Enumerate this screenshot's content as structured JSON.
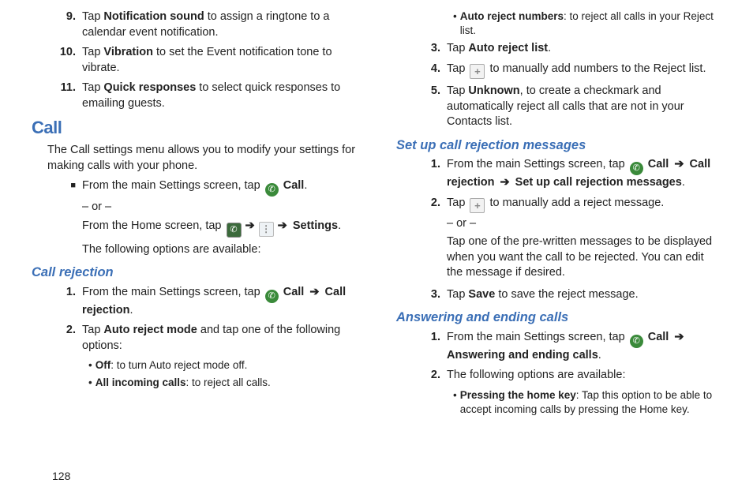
{
  "page_number": "128",
  "col1": {
    "step9_num": "9.",
    "step9_a": "Tap ",
    "step9_b": "Notification sound",
    "step9_c": " to assign a ringtone to a calendar event notification.",
    "step10_num": "10.",
    "step10_a": "Tap ",
    "step10_b": "Vibration",
    "step10_c": " to set the Event notification tone to vibrate.",
    "step11_num": "11.",
    "step11_a": "Tap ",
    "step11_b": "Quick responses",
    "step11_c": " to select quick responses to emailing guests.",
    "h_call": "Call",
    "call_intro": "The Call settings menu allows you to modify your settings for making calls with your phone.",
    "sq_bullet": "■",
    "main_a": "From the main Settings screen, tap ",
    "icon_phone": "✆",
    "call_label": " Call",
    "period": ".",
    "or": "– or –",
    "home_a": "From the Home screen, tap ",
    "icon_menu": "⋮",
    "arrow": "➔",
    "settings": " Settings",
    "options_avail": "The following options are available:",
    "h_rejection": "Call rejection",
    "r1_num": "1.",
    "r1_a": "From the main Settings screen, tap ",
    "r1_b": " Call ",
    "r1_c": " Call rejection",
    "r2_num": "2.",
    "r2_a": "Tap ",
    "r2_b": "Auto reject mode",
    "r2_c": " and tap one of the following options:",
    "off_b": "Off",
    "off_c": ": to turn Auto reject mode off.",
    "all_b": "All incoming calls",
    "all_c": ": to reject all calls.",
    "dot": "•"
  },
  "col2": {
    "arn_b": "Auto reject numbers",
    "arn_c": ": to reject all calls in your Reject list.",
    "s3_num": "3.",
    "s3_a": "Tap ",
    "s3_b": "Auto reject list",
    "s4_num": "4.",
    "s4_a": "Tap ",
    "icon_plus": "+",
    "s4_c": " to manually add numbers to the Reject list.",
    "s5_num": "5.",
    "s5_a": "Tap ",
    "s5_b": "Unknown",
    "s5_c": ", to create a checkmark and automatically reject all calls that are not in your Contacts list.",
    "h_msgs": "Set up call rejection messages",
    "m1_num": "1.",
    "m1_a": "From the main Settings screen, tap ",
    "m1_b": " Call ",
    "m1_c": " Call rejection ",
    "m1_d": " Set up call rejection messages",
    "m2_num": "2.",
    "m2_a": "Tap ",
    "m2_c": " to manually add a reject message.",
    "or": "– or –",
    "m2_sub": "Tap one of the pre-written messages to be displayed when you want the call to be rejected. You can edit the message if desired.",
    "m3_num": "3.",
    "m3_a": "Tap ",
    "m3_b": "Save",
    "m3_c": " to save the reject message.",
    "h_ans": "Answering and ending calls",
    "a1_num": "1.",
    "a1_a": "From the main Settings screen, tap ",
    "a1_b": " Call ",
    "a1_c": " Answering and ending calls",
    "a2_num": "2.",
    "a2_a": "The following options are available:",
    "hk_b": "Pressing the home key",
    "hk_c": ": Tap this option to be able to accept incoming calls by pressing the Home key.",
    "dot": "•",
    "arrow": "➔",
    "icon_phone": "✆",
    "period": "."
  }
}
